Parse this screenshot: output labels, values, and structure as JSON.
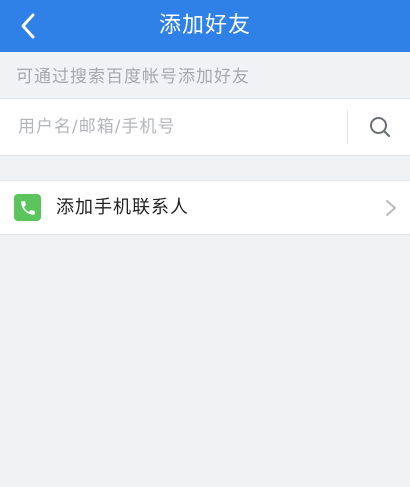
{
  "header": {
    "title": "添加好友",
    "back_icon": "chevron-left-icon"
  },
  "hint": "可通过搜索百度帐号添加好友",
  "search": {
    "placeholder": "用户名/邮箱/手机号",
    "value": "",
    "icon": "search-icon"
  },
  "contacts": {
    "label": "添加手机联系人",
    "icon": "phone-icon",
    "arrow_icon": "chevron-right-icon"
  },
  "colors": {
    "header_bg": "#2f81e8",
    "page_bg": "#f1f2f4",
    "phone_green": "#5cc45c"
  }
}
